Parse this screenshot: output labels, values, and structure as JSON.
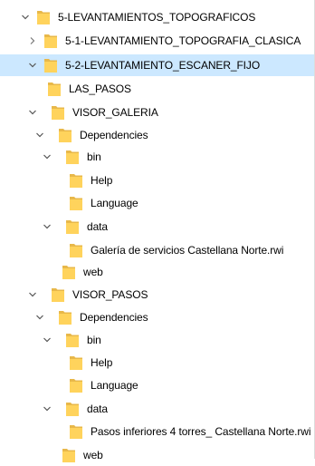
{
  "colors": {
    "selection": "#cce8ff",
    "folder_back": "#e8b84a",
    "folder_front": "#ffd35c",
    "chevron": "#555555"
  },
  "tree": {
    "items": [
      {
        "label": "5-LEVANTAMIENTOS_TOPOGRAFICOS",
        "expanded": true,
        "has_children": true,
        "selected": false,
        "icon": "folder-icon"
      },
      {
        "label": "5-1-LEVANTAMIENTO_TOPOGRAFIA_CLASICA",
        "expanded": false,
        "has_children": true,
        "selected": false,
        "icon": "folder-icon"
      },
      {
        "label": "5-2-LEVANTAMIENTO_ESCANER_FIJO",
        "expanded": true,
        "has_children": true,
        "selected": true,
        "icon": "folder-icon"
      },
      {
        "label": "LAS_PASOS",
        "expanded": false,
        "has_children": false,
        "selected": false,
        "icon": "folder-icon"
      },
      {
        "label": "VISOR_GALERIA",
        "expanded": true,
        "has_children": true,
        "selected": false,
        "icon": "folder-icon"
      },
      {
        "label": "Dependencies",
        "expanded": true,
        "has_children": true,
        "selected": false,
        "icon": "folder-icon"
      },
      {
        "label": "bin",
        "expanded": true,
        "has_children": true,
        "selected": false,
        "icon": "folder-icon"
      },
      {
        "label": "Help",
        "expanded": false,
        "has_children": false,
        "selected": false,
        "icon": "folder-icon"
      },
      {
        "label": "Language",
        "expanded": false,
        "has_children": false,
        "selected": false,
        "icon": "folder-icon"
      },
      {
        "label": "data",
        "expanded": true,
        "has_children": true,
        "selected": false,
        "icon": "folder-icon"
      },
      {
        "label": "Galería de servicios Castellana Norte.rwi",
        "expanded": false,
        "has_children": false,
        "selected": false,
        "icon": "folder-icon"
      },
      {
        "label": "web",
        "expanded": false,
        "has_children": false,
        "selected": false,
        "icon": "folder-icon"
      },
      {
        "label": "VISOR_PASOS",
        "expanded": true,
        "has_children": true,
        "selected": false,
        "icon": "folder-icon"
      },
      {
        "label": "Dependencies",
        "expanded": true,
        "has_children": true,
        "selected": false,
        "icon": "folder-icon"
      },
      {
        "label": "bin",
        "expanded": true,
        "has_children": true,
        "selected": false,
        "icon": "folder-icon"
      },
      {
        "label": "Help",
        "expanded": false,
        "has_children": false,
        "selected": false,
        "icon": "folder-icon"
      },
      {
        "label": "Language",
        "expanded": false,
        "has_children": false,
        "selected": false,
        "icon": "folder-icon"
      },
      {
        "label": "data",
        "expanded": true,
        "has_children": true,
        "selected": false,
        "icon": "folder-icon"
      },
      {
        "label": "Pasos inferiores 4 torres_ Castellana Norte.rwi",
        "expanded": false,
        "has_children": false,
        "selected": false,
        "icon": "folder-icon"
      },
      {
        "label": "web",
        "expanded": false,
        "has_children": false,
        "selected": false,
        "icon": "folder-icon"
      }
    ]
  }
}
